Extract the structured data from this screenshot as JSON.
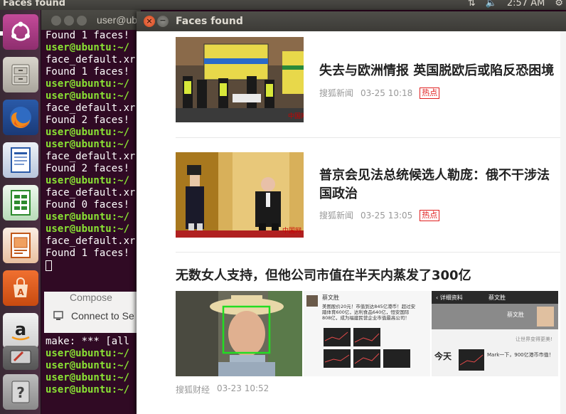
{
  "top_panel": {
    "app_title": "Faces found",
    "time": "2:57 AM"
  },
  "launcher": {
    "items": [
      {
        "name": "dash-home",
        "icon": "ubuntu-logo-icon"
      },
      {
        "name": "files",
        "icon": "file-cabinet-icon"
      },
      {
        "name": "firefox",
        "icon": "firefox-icon"
      },
      {
        "name": "libreoffice-writer",
        "icon": "writer-icon"
      },
      {
        "name": "libreoffice-calc",
        "icon": "calc-icon"
      },
      {
        "name": "libreoffice-impress",
        "icon": "impress-icon"
      },
      {
        "name": "software-center",
        "icon": "shopping-bag-icon"
      },
      {
        "name": "amazon",
        "icon": "amazon-icon"
      },
      {
        "name": "system-settings",
        "icon": "settings-icon"
      },
      {
        "name": "help",
        "icon": "help-icon"
      }
    ]
  },
  "terminal": {
    "title": "user@ubuntu",
    "lines": [
      {
        "type": "plain",
        "text": "Found 1 faces!"
      },
      {
        "type": "prompt",
        "text": "user@ubuntu:~/"
      },
      {
        "type": "plain",
        "text": "face_default.xr"
      },
      {
        "type": "plain",
        "text": "Found 1 faces!"
      },
      {
        "type": "prompt",
        "text": "user@ubuntu:~/"
      },
      {
        "type": "prompt",
        "text": "user@ubuntu:~/"
      },
      {
        "type": "plain",
        "text": "face_default.xr"
      },
      {
        "type": "plain",
        "text": "Found 2 faces!"
      },
      {
        "type": "prompt",
        "text": "user@ubuntu:~/"
      },
      {
        "type": "prompt",
        "text": "user@ubuntu:~/"
      },
      {
        "type": "plain",
        "text": "face_default.xr"
      },
      {
        "type": "plain",
        "text": "Found 2 faces!"
      },
      {
        "type": "prompt",
        "text": "user@ubuntu:~/"
      },
      {
        "type": "plain",
        "text": "face_default.xr"
      },
      {
        "type": "plain",
        "text": "Found 0 faces!"
      },
      {
        "type": "prompt",
        "text": "user@ubuntu:~/"
      },
      {
        "type": "prompt",
        "text": "user@ubuntu:~/"
      },
      {
        "type": "plain",
        "text": "face_default.xr"
      },
      {
        "type": "plain",
        "text": "Found 1 faces!"
      }
    ],
    "popup_row1": "Compose",
    "popup_row2": "Connect to Se",
    "lines_after": [
      {
        "type": "plain",
        "text": "make: *** [all"
      },
      {
        "type": "prompt",
        "text": "user@ubuntu:~/"
      },
      {
        "type": "prompt",
        "text": "user@ubuntu:~/"
      },
      {
        "type": "prompt",
        "text": "user@ubuntu:~/"
      },
      {
        "type": "prompt",
        "text": "user@ubuntu:~/"
      }
    ]
  },
  "faces_window": {
    "title": "Faces found",
    "articles": [
      {
        "headline": "失去与欧洲情报 英国脱欧后或陷反恐困境",
        "source": "搜狐新闻",
        "time": "03-25 10:18",
        "tag": "热点"
      },
      {
        "headline": "普京会见法总统候选人勒庞：俄不干涉法国政治",
        "source": "搜狐新闻",
        "time": "03-25 13:05",
        "tag": "热点"
      }
    ],
    "gallery_article": {
      "headline": "无数女人支持，但他公司市值在半天内蒸发了300亿",
      "source": "搜狐财经",
      "time": "03-23 10:52",
      "panel2_name": "蔡文胜",
      "panel2_text": "美图股价20元！市值到达845亿港币！超过安踏体育600亿，达利食品640亿，恒安国际808亿，成为福建民营企业市值最高公司！",
      "panel3_header_left": "详细资料",
      "panel3_header_title": "蔡文胜",
      "panel3_name": "蔡文胜",
      "panel3_tagline": "让世界变得更美!",
      "panel3_today": "今天",
      "panel3_mark": "Mark一下，900亿港币市值！"
    }
  },
  "colors": {
    "terminal_bg": "#300a24",
    "prompt_green": "#8ae234",
    "hot_tag": "#e02020",
    "face_box": "#22dd22"
  }
}
